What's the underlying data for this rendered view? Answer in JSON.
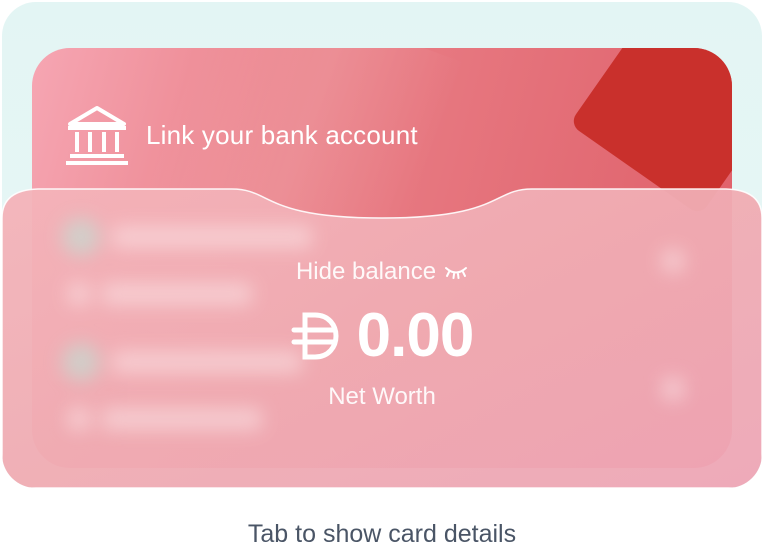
{
  "bank_card": {
    "link_label": "Link your bank account",
    "icon": "bank-icon",
    "colors": {
      "start": "#f6a6b3",
      "end": "#e05e68",
      "corner": "#c9302c"
    }
  },
  "balance_card": {
    "hide_balance_label": "Hide balance",
    "hide_icon": "eye-closed-icon",
    "currency_symbol": "dirham-icon",
    "amount": "0.00",
    "net_worth_label": "Net Worth"
  },
  "footer": {
    "hint": "Tab to show card details"
  },
  "theme": {
    "background": "#e3f5f4",
    "text_muted": "#4a5566"
  }
}
